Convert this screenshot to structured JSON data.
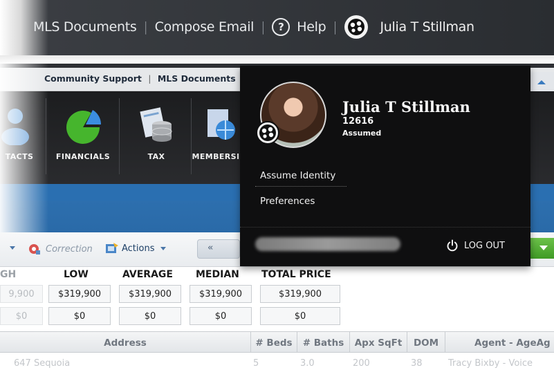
{
  "topbar": {
    "mls_documents": "MLS Documents",
    "compose_email": "Compose Email",
    "help": "Help",
    "help_icon": "?",
    "separator": "|",
    "user_name": "Julia T Stillman"
  },
  "subnav": {
    "community_support": "Community Support",
    "mls_documents": "MLS Documents",
    "separator": "|"
  },
  "nav": {
    "items": [
      {
        "label": "TACTS",
        "icon": "contacts-person-icon"
      },
      {
        "label": "FINANCIALS",
        "icon": "financials-pie-icon"
      },
      {
        "label": "TAX",
        "icon": "tax-database-icon"
      },
      {
        "label": "MEMBERSI",
        "icon": "membership-globe-icon"
      }
    ]
  },
  "toolbar": {
    "correction": "Correction",
    "actions": "Actions",
    "pager_prev": "«"
  },
  "stats": {
    "headers": [
      "GH",
      "LOW",
      "AVERAGE",
      "MEDIAN",
      "TOTAL PRICE"
    ],
    "row1": [
      "9,900",
      "$319,900",
      "$319,900",
      "$319,900",
      "$319,900"
    ],
    "row2": [
      "$0",
      "$0",
      "$0",
      "$0",
      "$0"
    ]
  },
  "table": {
    "columns": [
      "Address",
      "# Beds",
      "# Baths",
      "Apx SqFt",
      "DOM",
      "Agent - AgeAg"
    ],
    "row": [
      "647 Sequoia",
      "5",
      "3.0",
      "200",
      "38",
      "Tracy Bixby - Voice"
    ]
  },
  "user_panel": {
    "name": "Julia T Stillman",
    "id": "12616",
    "status": "Assumed",
    "assume_identity": "Assume Identity",
    "preferences": "Preferences",
    "logout": "LOG OUT"
  },
  "colors": {
    "topbar": "#2a2d31",
    "panel": "#0f0f10",
    "accent_blue": "#2a6fb1",
    "accent_green": "#4caf2f"
  }
}
